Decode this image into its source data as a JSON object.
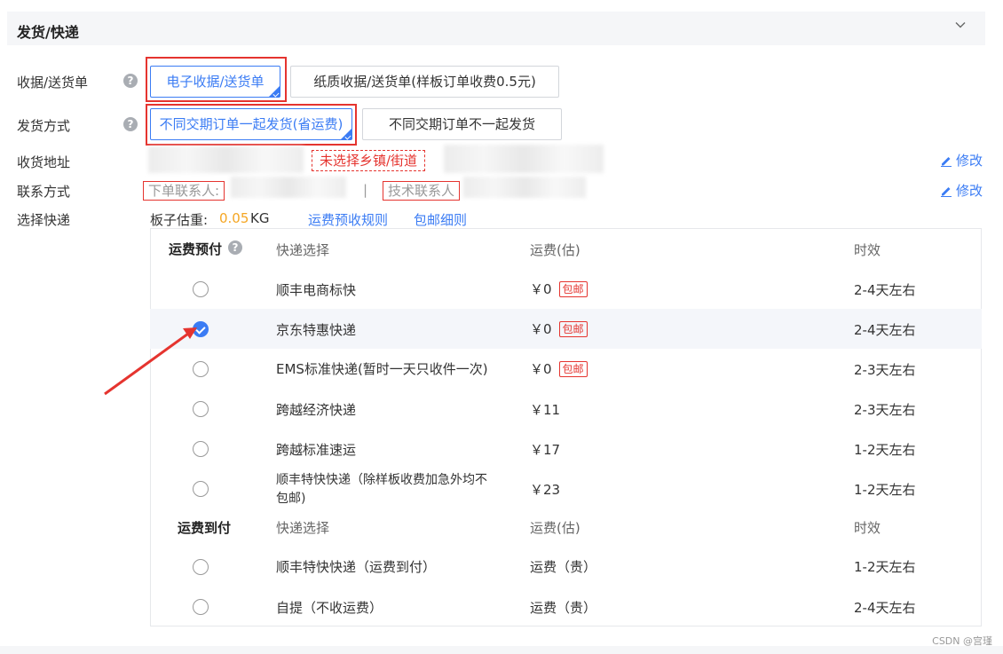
{
  "section": {
    "title": "发货/快递"
  },
  "receipt": {
    "label": "收据/送货单",
    "options": [
      "电子收据/送货单",
      "纸质收据/送货单(样板订单收费0.5元)"
    ]
  },
  "shipping_method": {
    "label": "发货方式",
    "options": [
      "不同交期订单一起发货(省运费)",
      "不同交期订单不一起发货"
    ]
  },
  "address": {
    "label": "收货地址",
    "warning": "未选择乡镇/街道",
    "edit_label": "修改"
  },
  "contact": {
    "label": "联系方式",
    "order_contact": "下单联系人:",
    "separator": "|",
    "tech_contact": "技术联系人",
    "edit_label": "修改"
  },
  "courier": {
    "label": "选择快递",
    "weight_label": "板子估重:",
    "weight_value": "0.05",
    "weight_unit": "KG",
    "link_rules": "运费预收规则",
    "link_free": "包邮细则"
  },
  "prepaid": {
    "group_label": "运费预付",
    "col_courier": "快递选择",
    "col_fee": "运费(估)",
    "col_time": "时效",
    "free_tag": "包邮",
    "rows": [
      {
        "name": "顺丰电商标快",
        "fee": "￥0",
        "free": true,
        "time": "2-4天左右",
        "selected": false
      },
      {
        "name": "京东特惠快递",
        "fee": "￥0",
        "free": true,
        "time": "2-4天左右",
        "selected": true
      },
      {
        "name": "EMS标准快递(暂时一天只收件一次)",
        "fee": "￥0",
        "free": true,
        "time": "2-3天左右",
        "selected": false
      },
      {
        "name": "跨越经济快递",
        "fee": "￥11",
        "free": false,
        "time": "2-3天左右",
        "selected": false
      },
      {
        "name": "跨越标准速运",
        "fee": "￥17",
        "free": false,
        "time": "1-2天左右",
        "selected": false
      },
      {
        "name_line1": "顺丰特快快递（除样板收费加急外均不",
        "name_line2": "包邮)",
        "fee": "￥23",
        "free": false,
        "time": "1-2天左右",
        "selected": false
      }
    ]
  },
  "collect": {
    "group_label": "运费到付",
    "col_courier": "快递选择",
    "col_fee": "运费(估)",
    "col_time": "时效",
    "rows": [
      {
        "name": "顺丰特快快递（运费到付）",
        "fee": "运费（贵）",
        "time": "1-2天左右",
        "selected": false
      },
      {
        "name": "自提（不收运费）",
        "fee": "运费（贵）",
        "time": "2-4天左右",
        "selected": false
      }
    ]
  },
  "watermark": "CSDN @宫瑾",
  "colors": {
    "accent": "#3b7cf4",
    "danger": "#e5342f",
    "weight": "#f5a623"
  }
}
